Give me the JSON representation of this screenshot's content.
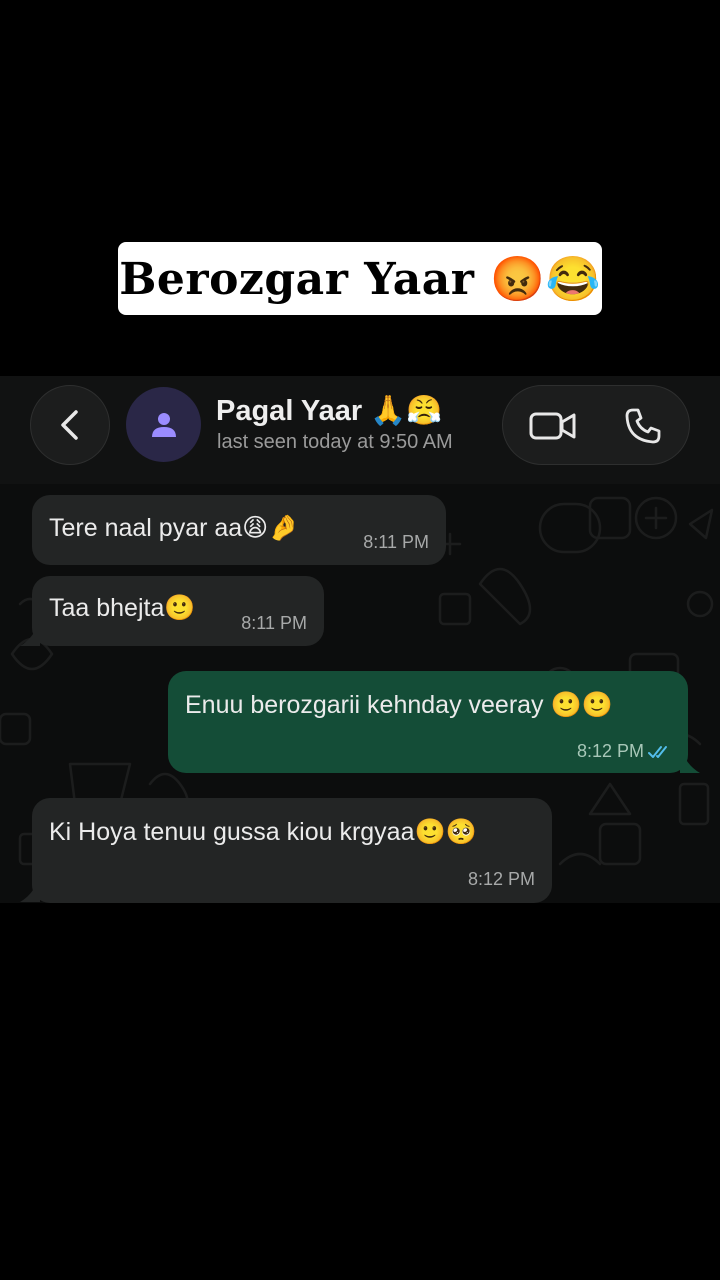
{
  "caption": {
    "text": "Berozgar Yaar 😡😂"
  },
  "header": {
    "back_icon": "chevron-left-icon",
    "avatar_icon": "person-icon",
    "contact_name": "Pagal Yaar 🙏😤",
    "last_seen": "last seen today at 9:50 AM",
    "video_icon": "video-camera-icon",
    "voice_icon": "phone-icon"
  },
  "colors": {
    "incoming_bubble": "#232525",
    "outgoing_bubble": "#144d37",
    "avatar_bg": "#2a2747",
    "avatar_fg": "#9b8cff",
    "read_ticks": "#53bdeb"
  },
  "messages": [
    {
      "direction": "incoming",
      "text": "Tere naal pyar aa😩🤌",
      "time": "8:11 PM"
    },
    {
      "direction": "incoming",
      "text": "Taa bhejta🙂",
      "time": "8:11 PM"
    },
    {
      "direction": "outgoing",
      "text": "Enuu berozgarii kehnday veeray 🙂🙂",
      "time": "8:12 PM",
      "status": "read"
    },
    {
      "direction": "incoming",
      "text": "Ki Hoya tenuu gussa kiou krgyaa🙂🥺",
      "time": "8:12 PM"
    }
  ]
}
